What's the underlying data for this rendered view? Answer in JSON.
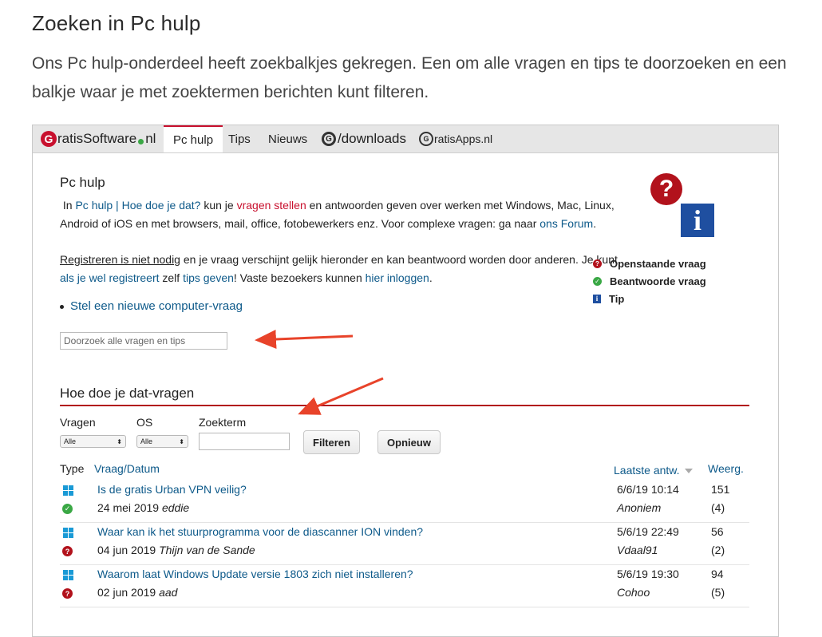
{
  "article": {
    "title": "Zoeken in Pc hulp",
    "intro": "Ons Pc hulp-onderdeel heeft zoekbalkjes gekregen. Een om alle vragen en tips te doorzoeken en een balkje waar je met zoektermen berichten kunt filteren."
  },
  "nav": {
    "logo_g": "G",
    "logo_text": "ratisSoftware",
    "logo_tld": "nl",
    "tabs": [
      "Pc hulp",
      "Tips",
      "Nieuws"
    ],
    "downloads_g": "G",
    "downloads_label": "/downloads",
    "apps_g": "G",
    "apps_label": "ratisApps.nl"
  },
  "pchulp": {
    "title": "Pc hulp",
    "p1_in": "In",
    "p1_link1": "Pc hulp | Hoe doe je dat?",
    "p1_text1": "kun je",
    "p1_link2": "vragen stellen",
    "p1_text2": "en antwoorden geven over werken met Windows, Mac, Linux, Android of iOS en met browsers, mail, office, fotobewerkers enz. Voor complexe vragen: ga naar",
    "p1_link3": "ons Forum",
    "p1_end": ".",
    "p2_u": "Registreren is niet nodig",
    "p2_text1": "en je vraag verschijnt gelijk hieronder en kan beantwoord worden door anderen. Je kunt",
    "p2_link1": "als je wel registreert",
    "p2_text2": "zelf",
    "p2_link2": "tips geven",
    "p2_text3": "! Vaste bezoekers kunnen",
    "p2_link3": "hier inloggen",
    "p2_end": ".",
    "new_question": "Stel een nieuwe computer-vraag",
    "search_placeholder": "Doorzoek alle vragen en tips"
  },
  "icons": {
    "question": "?",
    "info": "i"
  },
  "legend": [
    {
      "icon": "question-icon",
      "label": "Openstaande vraag"
    },
    {
      "icon": "check-icon",
      "label": "Beantwoorde vraag"
    },
    {
      "icon": "info-icon",
      "label": "Tip"
    }
  ],
  "howto": {
    "title": "Hoe doe je dat-vragen",
    "filter_labels": {
      "vragen": "Vragen",
      "os": "OS",
      "zoekterm": "Zoekterm"
    },
    "select_vragen": "Alle",
    "select_os": "Alle",
    "btn_filter": "Filteren",
    "btn_reset": "Opnieuw"
  },
  "table": {
    "headers": {
      "type": "Type",
      "vraag": "Vraag/Datum",
      "laatste": "Laatste antw.",
      "weerg": "Weerg."
    },
    "rows": [
      {
        "title": "Is de gratis Urban VPN veilig?",
        "date": "24 mei 2019",
        "author": "eddie",
        "last": "6/6/19 10:14",
        "by": "Anoniem",
        "views": "151",
        "replies": "(4)",
        "status": "answered"
      },
      {
        "title": "Waar kan ik het stuurprogramma voor de diascanner ION vinden?",
        "date": "04 jun 2019",
        "author": "Thijn van de Sande",
        "last": "5/6/19 22:49",
        "by": "Vdaal91",
        "views": "56",
        "replies": "(2)",
        "status": "open"
      },
      {
        "title": "Waarom laat Windows Update versie 1803 zich niet installeren?",
        "date": "02 jun 2019",
        "author": "aad",
        "last": "5/6/19 19:30",
        "by": "Cohoo",
        "views": "94",
        "replies": "(5)",
        "status": "open"
      }
    ]
  },
  "colors": {
    "brand_red": "#c8102e",
    "link_blue": "#0e5a8a",
    "arrow_red": "#e8432a",
    "ok_green": "#3aa845",
    "info_blue": "#1f4fa0"
  }
}
